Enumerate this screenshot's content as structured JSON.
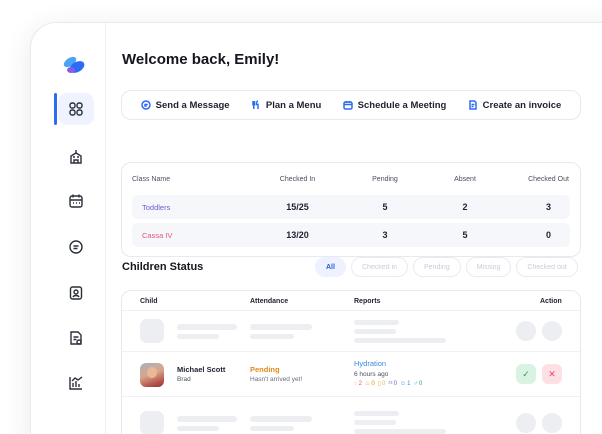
{
  "greeting": "Welcome back, Emily!",
  "quick_actions": [
    {
      "label": "Send a Message",
      "icon": "message-icon"
    },
    {
      "label": "Plan a Menu",
      "icon": "utensils-icon"
    },
    {
      "label": "Schedule a Meeting",
      "icon": "calendar-icon"
    },
    {
      "label": "Create an invoice",
      "icon": "invoice-icon"
    }
  ],
  "summary": {
    "headers": [
      "Class Name",
      "Checked In",
      "Pending",
      "Absent",
      "Checked Out"
    ],
    "rows": [
      {
        "class": "Toddlers",
        "checked_in": "15/25",
        "pending": "5",
        "absent": "2",
        "checked_out": "3"
      },
      {
        "class": "Cassa IV",
        "checked_in": "13/20",
        "pending": "3",
        "absent": "5",
        "checked_out": "0"
      }
    ]
  },
  "children_status": {
    "title": "Children Status",
    "filters": [
      "All",
      "Checked in",
      "Pending",
      "Missing",
      "Checked out"
    ],
    "active_filter": "All",
    "headers": {
      "child": "Child",
      "attendance": "Attendance",
      "reports": "Reports",
      "action": "Action"
    },
    "child": {
      "name": "Michael Scott",
      "sub": "Brad",
      "attendance": "Pending",
      "attendance_sub": "Hasn't arrived yet!",
      "report_title": "Hydration",
      "report_time": "6 hours ago",
      "report_counts": [
        "2",
        "0",
        "0",
        "0",
        "1",
        "0"
      ]
    }
  },
  "colors": {
    "accent": "#2b6cf6",
    "pending": "#e38a1b",
    "toddlers": "#6b5bd6",
    "cassa": "#e0557d"
  }
}
